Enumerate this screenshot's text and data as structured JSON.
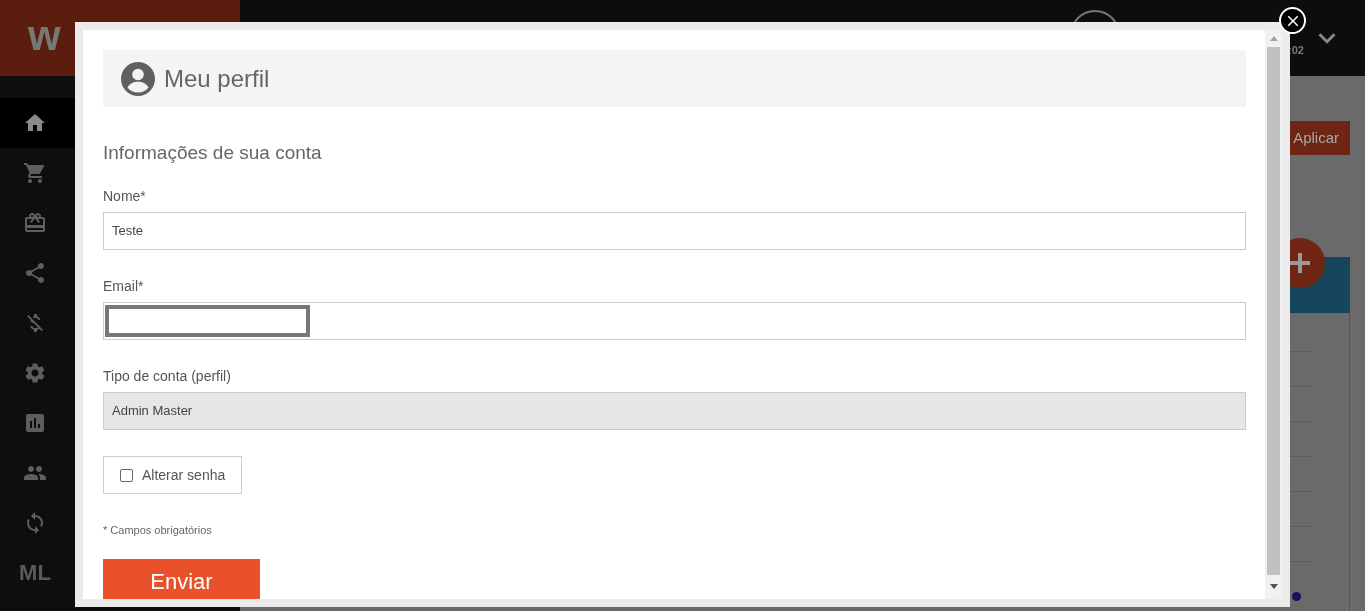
{
  "header": {
    "logo_text": "w",
    "clock_text": ":02"
  },
  "sidebar": {
    "items": [
      {
        "kind": "icon",
        "selected": true
      },
      {
        "kind": "icon",
        "selected": false
      },
      {
        "kind": "icon",
        "selected": false
      },
      {
        "kind": "icon",
        "selected": false
      },
      {
        "kind": "icon",
        "selected": false
      },
      {
        "kind": "icon",
        "selected": false
      },
      {
        "kind": "icon",
        "selected": false
      },
      {
        "kind": "icon",
        "selected": false
      },
      {
        "kind": "icon",
        "selected": false
      },
      {
        "kind": "text",
        "icon_text": "ML",
        "selected": false
      }
    ]
  },
  "content": {
    "apply_button": "Aplicar"
  },
  "modal": {
    "title": "Meu perfil",
    "section_title": "Informações de sua conta",
    "fields": [
      {
        "label": "Nome*",
        "value": "Teste",
        "disabled": false,
        "redacted": false
      },
      {
        "label": "Email*",
        "disabled": false,
        "redacted": true
      },
      {
        "label": "Tipo de conta (perfil)",
        "value": "Admin Master",
        "disabled": true,
        "redacted": false
      }
    ],
    "checkbox": {
      "label": "Alterar senha",
      "checked": false
    },
    "required_note": "* Campos obrigatórios",
    "submit_button": "Enviar"
  }
}
